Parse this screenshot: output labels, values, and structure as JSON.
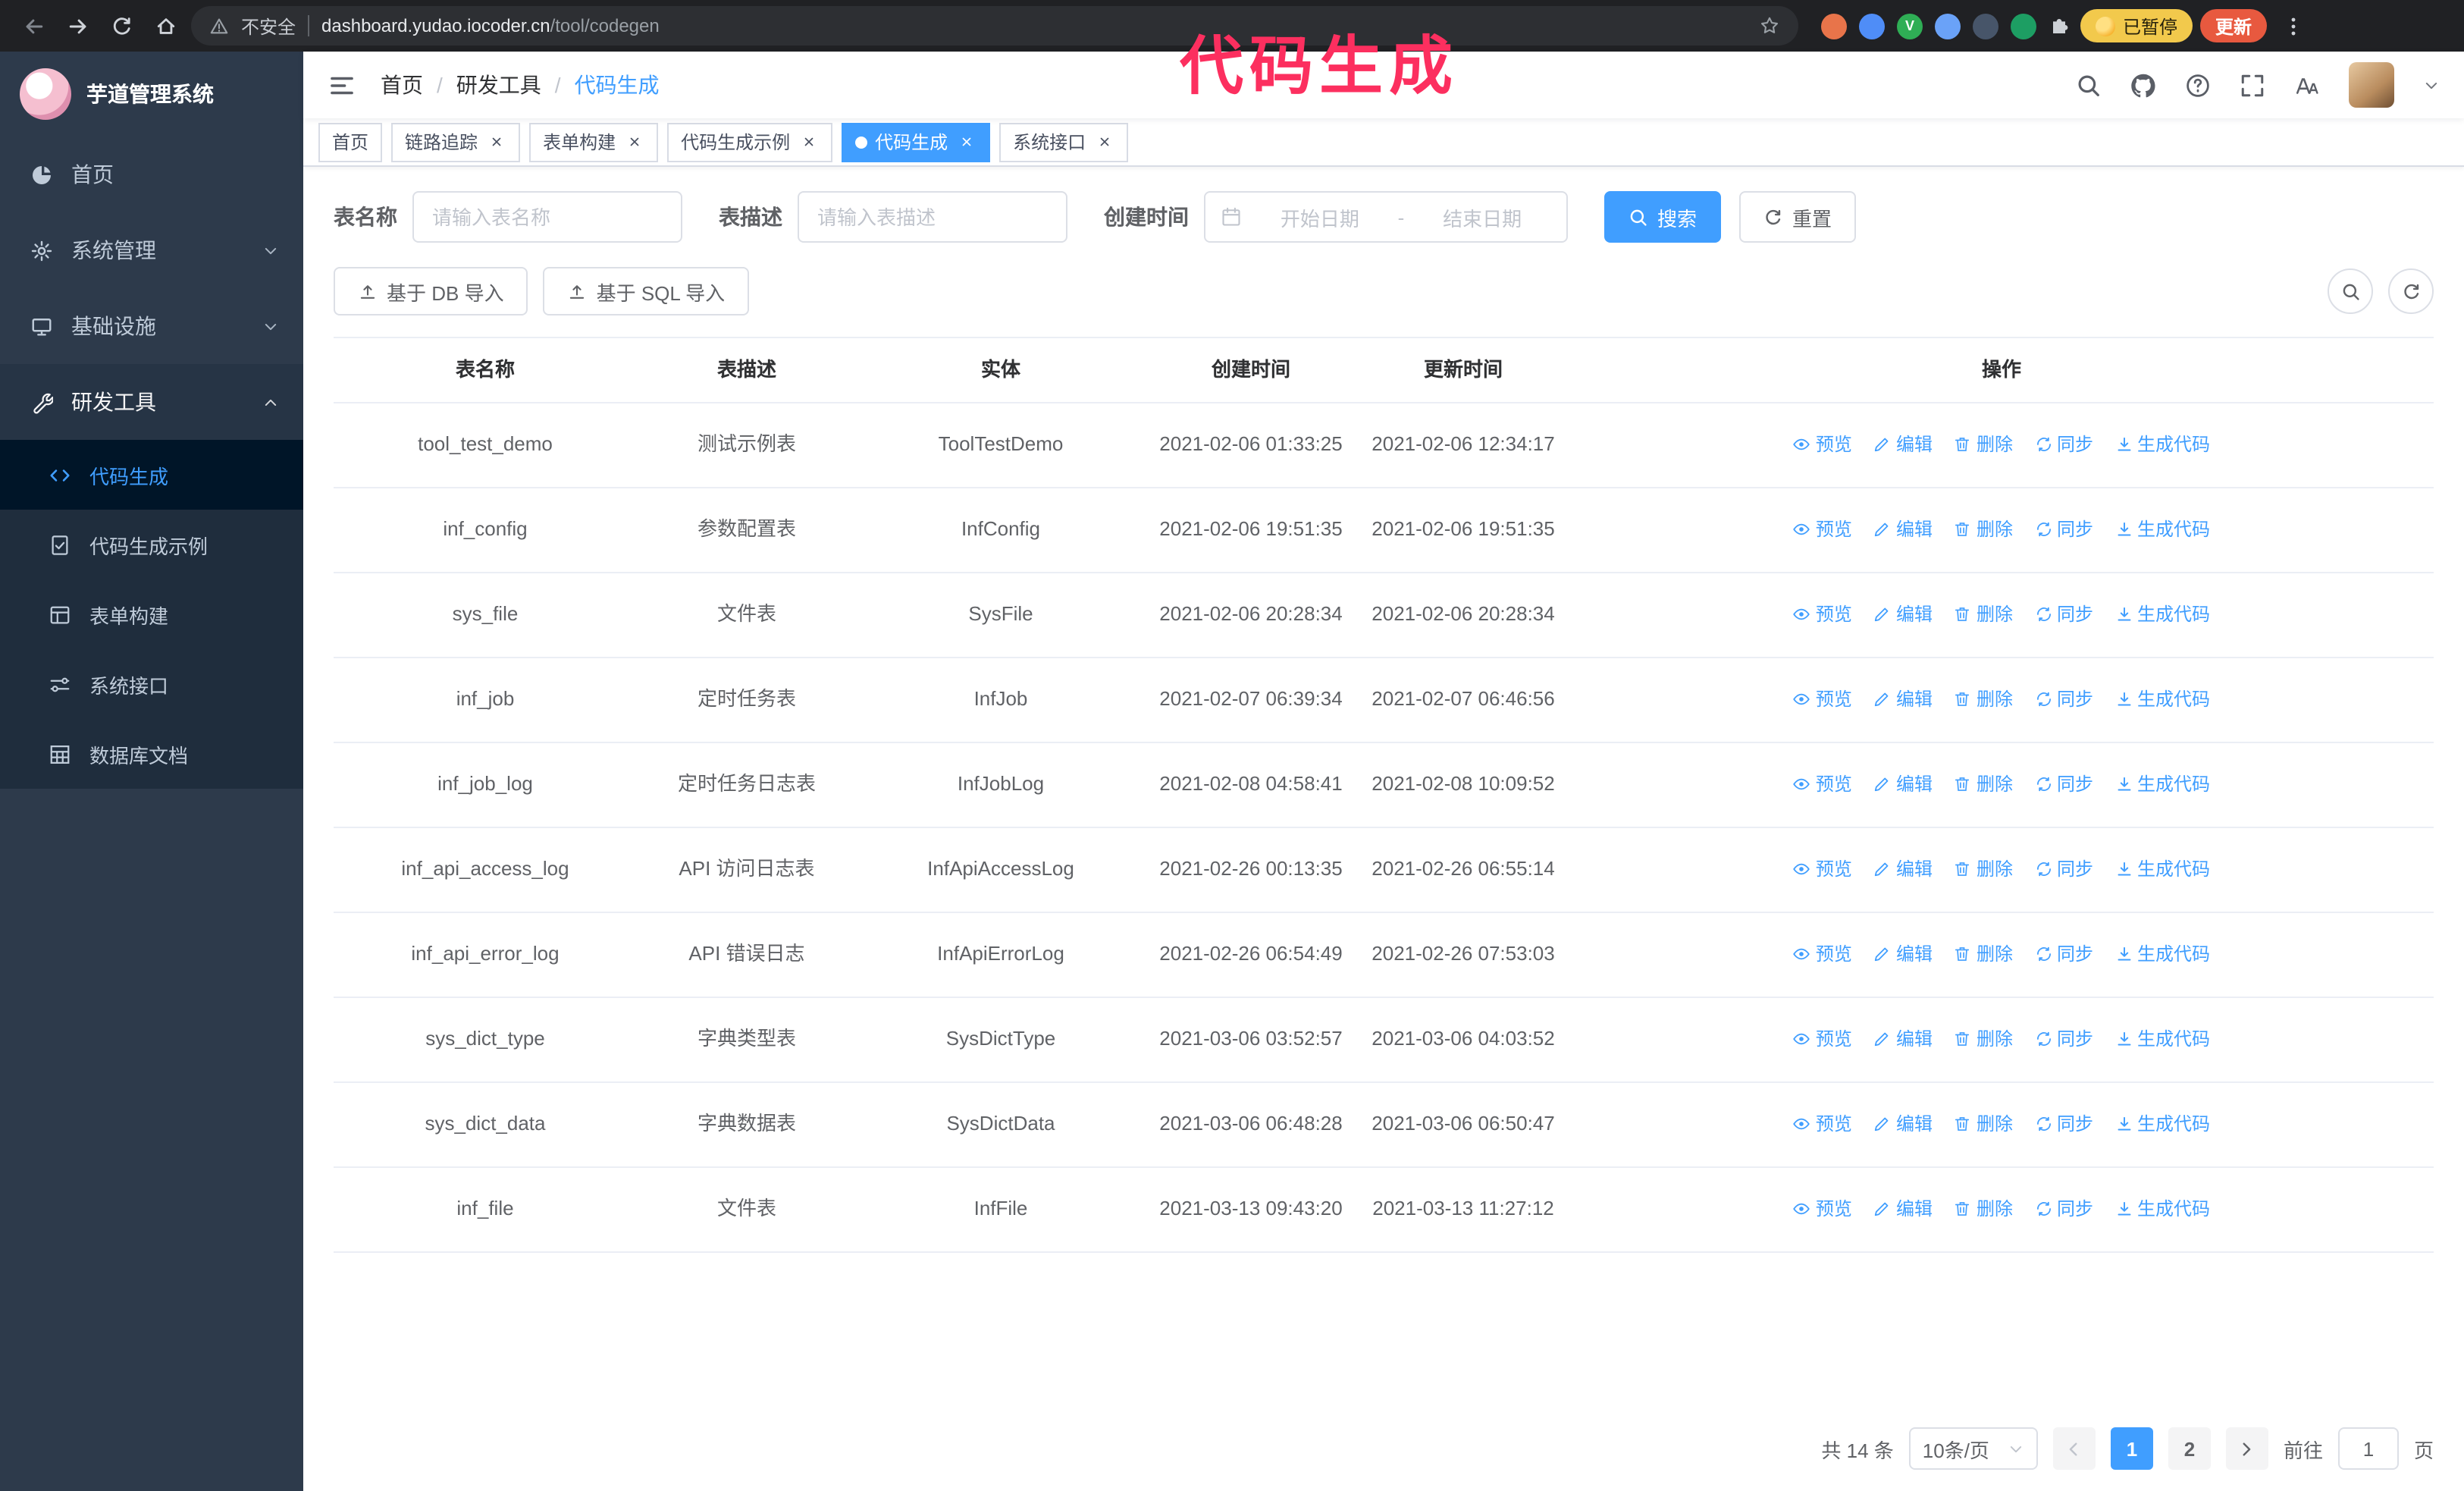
{
  "browser": {
    "security_label": "不安全",
    "url_domain": "dashboard.yudao.iocoder.cn",
    "url_path": "/tool/codegen",
    "paused_badge": "已暂停",
    "update_button": "更新"
  },
  "annotation": "代码生成",
  "sidebar": {
    "logo_title": "芋道管理系统",
    "items": [
      {
        "label": "首页",
        "icon": "dashboard-icon"
      },
      {
        "label": "系统管理",
        "icon": "gear-icon",
        "expandable": true
      },
      {
        "label": "基础设施",
        "icon": "infra-icon",
        "expandable": true
      },
      {
        "label": "研发工具",
        "icon": "tool-icon",
        "expandable": true,
        "expanded": true
      }
    ],
    "submenu": [
      {
        "label": "代码生成",
        "icon": "code-icon",
        "active": true
      },
      {
        "label": "代码生成示例",
        "icon": "example-icon"
      },
      {
        "label": "表单构建",
        "icon": "form-icon"
      },
      {
        "label": "系统接口",
        "icon": "api-icon"
      },
      {
        "label": "数据库文档",
        "icon": "dbdoc-icon"
      }
    ]
  },
  "header": {
    "breadcrumb": [
      "首页",
      "研发工具",
      "代码生成"
    ],
    "icons": [
      "search-icon",
      "github-icon",
      "question-icon",
      "fullscreen-icon",
      "fontsize-icon"
    ]
  },
  "tabs": [
    {
      "label": "首页",
      "closable": false,
      "active": false
    },
    {
      "label": "链路追踪",
      "closable": true,
      "active": false
    },
    {
      "label": "表单构建",
      "closable": true,
      "active": false
    },
    {
      "label": "代码生成示例",
      "closable": true,
      "active": false
    },
    {
      "label": "代码生成",
      "closable": true,
      "active": true
    },
    {
      "label": "系统接口",
      "closable": true,
      "active": false
    }
  ],
  "filters": {
    "table_name_label": "表名称",
    "table_name_placeholder": "请输入表名称",
    "table_desc_label": "表描述",
    "table_desc_placeholder": "请输入表描述",
    "create_time_label": "创建时间",
    "date_start_placeholder": "开始日期",
    "date_separator": "-",
    "date_end_placeholder": "结束日期",
    "search_button": "搜索",
    "reset_button": "重置"
  },
  "toolbar": {
    "import_db_button": "基于 DB 导入",
    "import_sql_button": "基于 SQL 导入",
    "right_buttons": [
      "search-icon",
      "refresh-icon"
    ]
  },
  "table": {
    "columns": [
      "表名称",
      "表描述",
      "实体",
      "创建时间",
      "更新时间",
      "操作"
    ],
    "actions": [
      "预览",
      "编辑",
      "删除",
      "同步",
      "生成代码"
    ],
    "rows": [
      {
        "name": "tool_test_demo",
        "desc": "测试示例表",
        "entity": "ToolTestDemo",
        "created": "2021-02-06 01:33:25",
        "updated": "2021-02-06 12:34:17"
      },
      {
        "name": "inf_config",
        "desc": "参数配置表",
        "entity": "InfConfig",
        "created": "2021-02-06 19:51:35",
        "updated": "2021-02-06 19:51:35"
      },
      {
        "name": "sys_file",
        "desc": "文件表",
        "entity": "SysFile",
        "created": "2021-02-06 20:28:34",
        "updated": "2021-02-06 20:28:34"
      },
      {
        "name": "inf_job",
        "desc": "定时任务表",
        "entity": "InfJob",
        "created": "2021-02-07 06:39:34",
        "updated": "2021-02-07 06:46:56"
      },
      {
        "name": "inf_job_log",
        "desc": "定时任务日志表",
        "entity": "InfJobLog",
        "created": "2021-02-08 04:58:41",
        "updated": "2021-02-08 10:09:52"
      },
      {
        "name": "inf_api_access_log",
        "desc": "API 访问日志表",
        "entity": "InfApiAccessLog",
        "created": "2021-02-26 00:13:35",
        "updated": "2021-02-26 06:55:14"
      },
      {
        "name": "inf_api_error_log",
        "desc": "API 错误日志",
        "entity": "InfApiErrorLog",
        "created": "2021-02-26 06:54:49",
        "updated": "2021-02-26 07:53:03"
      },
      {
        "name": "sys_dict_type",
        "desc": "字典类型表",
        "entity": "SysDictType",
        "created": "2021-03-06 03:52:57",
        "updated": "2021-03-06 04:03:52"
      },
      {
        "name": "sys_dict_data",
        "desc": "字典数据表",
        "entity": "SysDictData",
        "created": "2021-03-06 06:48:28",
        "updated": "2021-03-06 06:50:47"
      },
      {
        "name": "inf_file",
        "desc": "文件表",
        "entity": "InfFile",
        "created": "2021-03-13 09:43:20",
        "updated": "2021-03-13 11:27:12"
      }
    ]
  },
  "pagination": {
    "total_text": "共 14 条",
    "page_size": "10条/页",
    "pages": [
      "1",
      "2"
    ],
    "active_page": "1",
    "goto_label": "前往",
    "goto_value": "1",
    "goto_suffix": "页"
  },
  "colors": {
    "primary": "#409eff",
    "sidebar_bg": "#2d3a4b",
    "submenu_bg": "#1f2d3d",
    "submenu_active_bg": "#001528",
    "annotation": "#fc2f5f",
    "update_button_bg": "#e8593f",
    "paused_badge_bg": "#f2c94c"
  }
}
